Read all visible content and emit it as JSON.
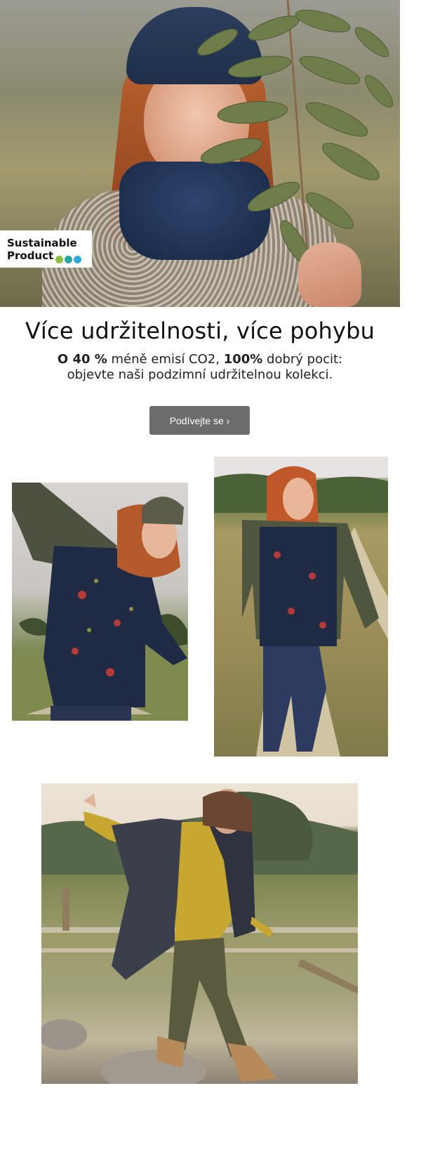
{
  "hero": {
    "badge": {
      "line1": "Sustainable",
      "line2": "Product",
      "dot_colors": [
        "#8cbf3f",
        "#26a9a4",
        "#29a9e0"
      ]
    }
  },
  "headline": "Více udržitelnosti, více pohybu",
  "subline": {
    "part1_bold": "O 40 %",
    "part2": " méně emisí CO2, ",
    "part3_bold": "100%",
    "part4": " dobrý pocit:",
    "line2": "objevte naši podzimní udržitelnou kolekci."
  },
  "cta": {
    "label": "Podívejte se ›"
  },
  "colors": {
    "cta_bg": "#6c6c6c",
    "cta_text": "#ffffff"
  }
}
